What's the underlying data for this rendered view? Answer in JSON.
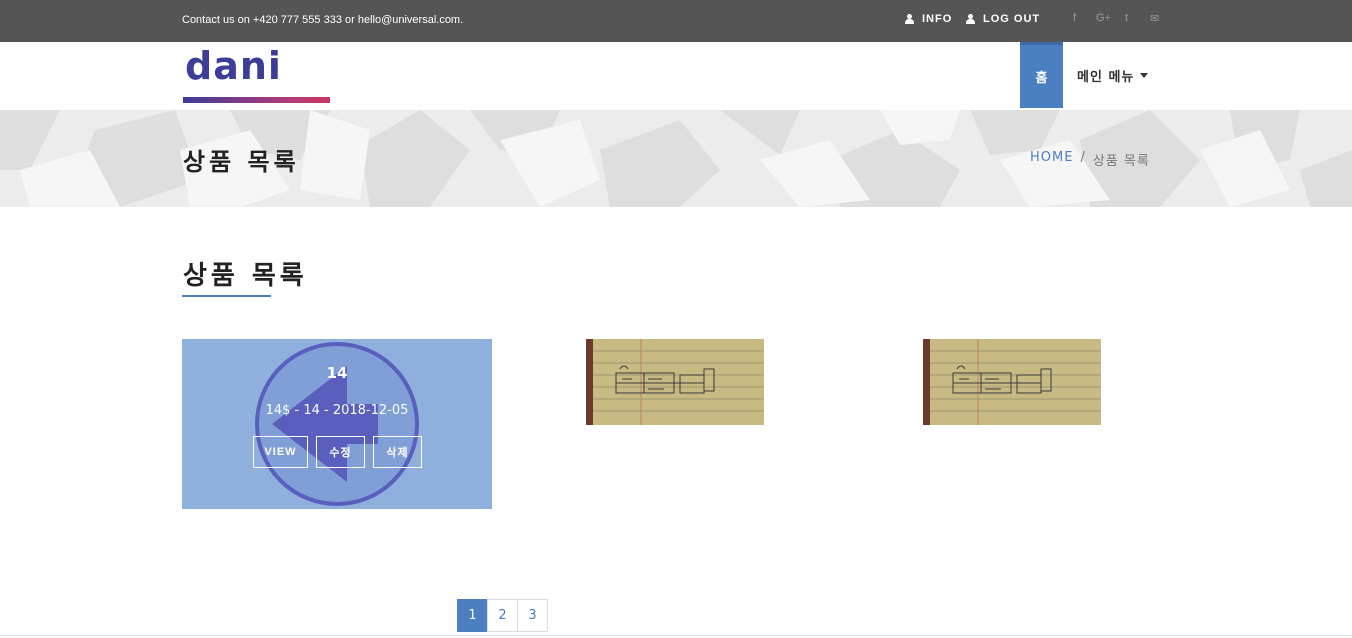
{
  "topbar": {
    "contact": "Contact us on +420 777 555 333 or hello@universal.com.",
    "info_label": "INFO",
    "logout_label": "LOG OUT",
    "social": [
      {
        "icon": "facebook-icon",
        "glyph": "f"
      },
      {
        "icon": "google-plus-icon",
        "glyph": "G+"
      },
      {
        "icon": "twitter-icon",
        "glyph": "t"
      },
      {
        "icon": "mail-icon",
        "glyph": "✉"
      }
    ]
  },
  "nav": {
    "logo_text": "dani",
    "home_label": "홈",
    "menu_label": "메인 메뉴"
  },
  "heading": {
    "title": "상품 목록",
    "breadcrumb_home": "HOME",
    "breadcrumb_sep": "/",
    "breadcrumb_current": "상품 목록"
  },
  "section": {
    "title": "상품 목록"
  },
  "products": [
    {
      "name": "14",
      "meta": "14$ - 14 - 2018-12-05",
      "view_label": "VIEW",
      "edit_label": "수정",
      "delete_label": "삭제"
    }
  ],
  "pagination": {
    "pages": [
      "1",
      "2",
      "3"
    ],
    "active": "1"
  },
  "colors": {
    "accent": "#4a7fc1",
    "topbar": "#555555",
    "logo_primary": "#3b3d97",
    "logo_secondary": "#c8355f"
  }
}
